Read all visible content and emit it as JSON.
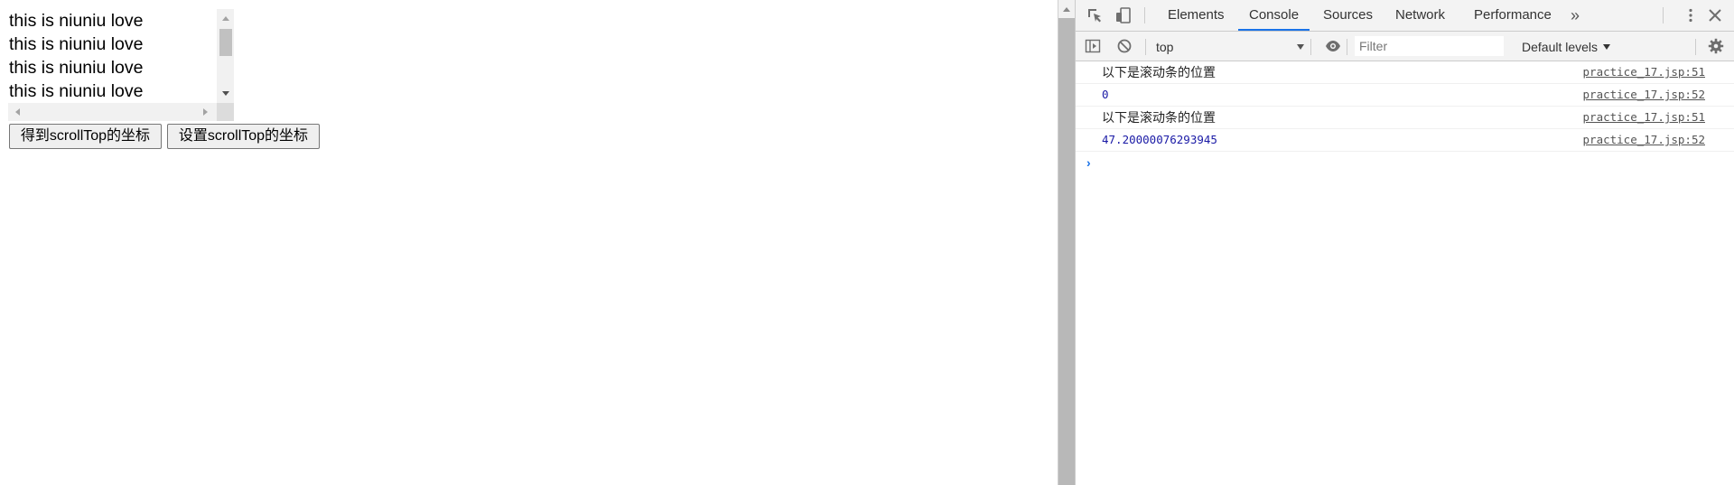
{
  "page": {
    "scroll_lines": [
      "this is niuniu love",
      "this is niuniu love",
      "this is niuniu love",
      "this is niuniu love"
    ],
    "buttons": {
      "get_label": "得到scrollTop的坐标",
      "set_label": "设置scrollTop的坐标"
    }
  },
  "devtools": {
    "tabs": [
      "Elements",
      "Console",
      "Sources",
      "Network",
      "Performance"
    ],
    "active_tab": "Console",
    "more_tabs_icon": "»",
    "toolbar": {
      "context": "top",
      "filter_placeholder": "Filter",
      "levels": "Default levels"
    },
    "messages": [
      {
        "text": "以下是滚动条的位置",
        "type": "string",
        "source": "practice_17.jsp:51"
      },
      {
        "text": "0",
        "type": "number",
        "source": "practice_17.jsp:52"
      },
      {
        "text": "以下是滚动条的位置",
        "type": "string",
        "source": "practice_17.jsp:51"
      },
      {
        "text": "47.20000076293945",
        "type": "number",
        "source": "practice_17.jsp:52"
      }
    ],
    "prompt_symbol": "›"
  },
  "colors": {
    "accent": "#1a73e8",
    "number": "#1a1aa6"
  }
}
